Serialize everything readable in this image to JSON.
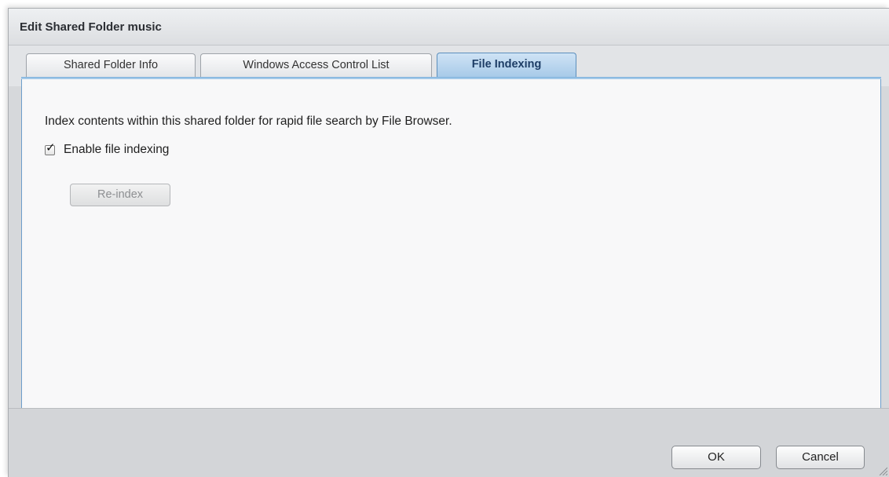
{
  "dialog": {
    "title": "Edit Shared Folder music"
  },
  "tabs": [
    {
      "label": "Shared Folder Info",
      "active": false
    },
    {
      "label": "Windows Access Control List",
      "active": false
    },
    {
      "label": "File Indexing",
      "active": true
    }
  ],
  "file_indexing": {
    "description": "Index contents within this shared folder for rapid file search by File Browser.",
    "enable_checkbox": {
      "label": "Enable file indexing",
      "checked": true
    },
    "reindex_button": {
      "label": "Re-index",
      "enabled": false
    }
  },
  "footer": {
    "ok_label": "OK",
    "cancel_label": "Cancel"
  },
  "colors": {
    "active_tab": "#a6c9e8",
    "panel_border": "#6d9ecb",
    "dialog_bg": "#d6d8db"
  }
}
